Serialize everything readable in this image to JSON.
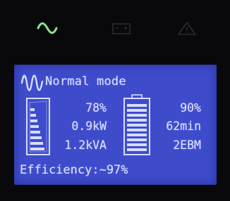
{
  "status_leds": {
    "ac_icon": "sine-wave-icon",
    "battery_icon": "battery-icon",
    "fault_icon": "warning-triangle-icon",
    "ac_color": "#7ee08c"
  },
  "lcd": {
    "background": "#3e4ccc",
    "mode": "Normal mode",
    "load": {
      "percent": "78%",
      "power_kw": "0.9kW",
      "apparent_power_kva": "1.2kVA"
    },
    "battery": {
      "percent": "90%",
      "runtime": "62min",
      "ebm": "2EBM"
    },
    "efficiency": "Efficiency:~97%"
  }
}
